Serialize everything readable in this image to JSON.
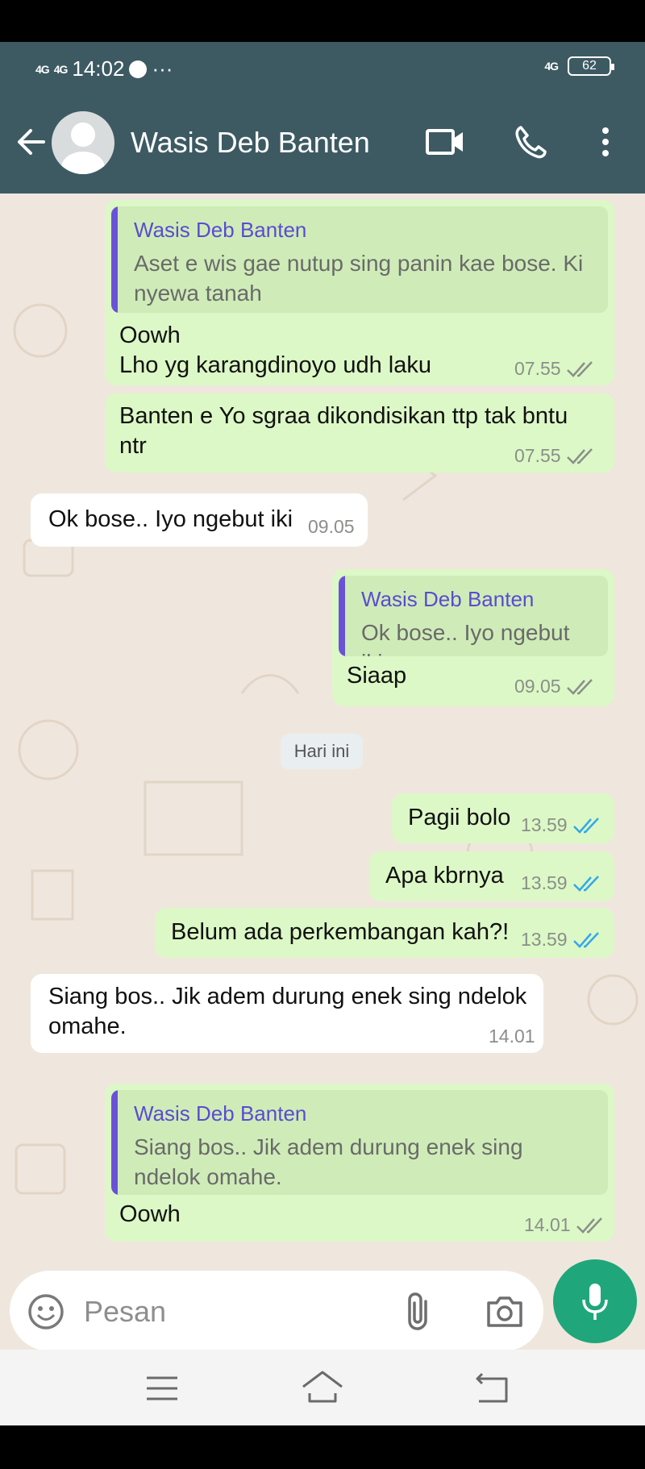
{
  "status_bar": {
    "net1": "4G",
    "net2": "4G",
    "time": "14:02",
    "more": "···",
    "net_right": "4G",
    "battery": "62"
  },
  "header": {
    "contact_name": "Wasis Deb Banten"
  },
  "chat": {
    "day_separator": "Hari ini",
    "messages": [
      {
        "quote_name": "Wasis Deb Banten",
        "quote_line1": "Aset e wis gae nutup sing panin kae bose. Ki",
        "quote_line2": "nyewa tanah",
        "line1": "Oowh",
        "line2": "Lho yg karangdinoyo udh laku",
        "time": "07.55"
      },
      {
        "line1": "Banten e Yo sgraa dikondisikan ttp tak bntu",
        "line2": "ntr",
        "time": "07.55"
      },
      {
        "text": "Ok bose.. Iyo ngebut iki",
        "time": "09.05"
      },
      {
        "quote_name": "Wasis Deb Banten",
        "quote_line1": "Ok bose.. Iyo ngebut iki",
        "text": "Siaap",
        "time": "09.05"
      },
      {
        "text": "Pagii bolo",
        "time": "13.59"
      },
      {
        "text": "Apa kbrnya",
        "time": "13.59"
      },
      {
        "text": "Belum ada perkembangan kah?!",
        "time": "13.59"
      },
      {
        "line1": "Siang bos.. Jik adem durung enek sing ndelok",
        "line2": "omahe.",
        "time": "14.01"
      },
      {
        "quote_name": "Wasis Deb Banten",
        "quote_line1": "Siang bos.. Jik adem durung enek sing",
        "quote_line2": "ndelok omahe.",
        "text": "Oowh",
        "time": "14.01"
      }
    ]
  },
  "input": {
    "placeholder": "Pesan"
  },
  "colors": {
    "header": "#3d5a63",
    "outgoing_bubble": "#dcf8c6",
    "incoming_bubble": "#ffffff",
    "read_tick": "#34a8e8",
    "sent_tick": "#8a8f8a",
    "mic_button": "#1fa67a",
    "quote_bar": "#6a52d8"
  },
  "icons": {
    "back": "arrow-left-icon",
    "video": "video-camera-icon",
    "call": "phone-icon",
    "menu": "more-vertical-icon",
    "emoji": "emoji-icon",
    "attach": "paperclip-icon",
    "camera": "camera-icon",
    "mic": "microphone-icon"
  }
}
